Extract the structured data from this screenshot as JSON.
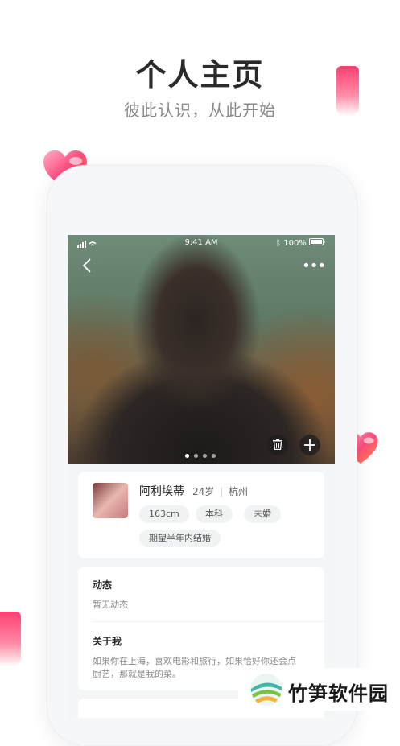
{
  "header": {
    "title": "个人主页",
    "subtitle": "彼此认识，从此开始"
  },
  "status_bar": {
    "time": "9:41 AM",
    "battery": "100%"
  },
  "photo": {
    "page_count": 4,
    "active_index": 0
  },
  "profile": {
    "name": "阿利埃蒂",
    "age": "24岁",
    "city": "杭州",
    "tags": [
      "163cm",
      "本科",
      "未婚",
      "期望半年内结婚"
    ]
  },
  "moments": {
    "title": "动态",
    "empty_text": "暂无动态"
  },
  "about": {
    "title": "关于我",
    "line1": "如果你在上海，喜欢电影和旅行，如果恰好你还会点",
    "line2": "厨艺，那就是我的菜。"
  },
  "watermark": {
    "text": "竹笋软件园"
  },
  "colors": {
    "accent": "#ff3e72",
    "tag_bg": "#f1f2f4"
  },
  "icons": [
    "back-icon",
    "more-icon",
    "delete-icon",
    "add-icon",
    "signal-icon",
    "wifi-icon",
    "bluetooth-icon",
    "battery-icon",
    "heart-icon"
  ]
}
